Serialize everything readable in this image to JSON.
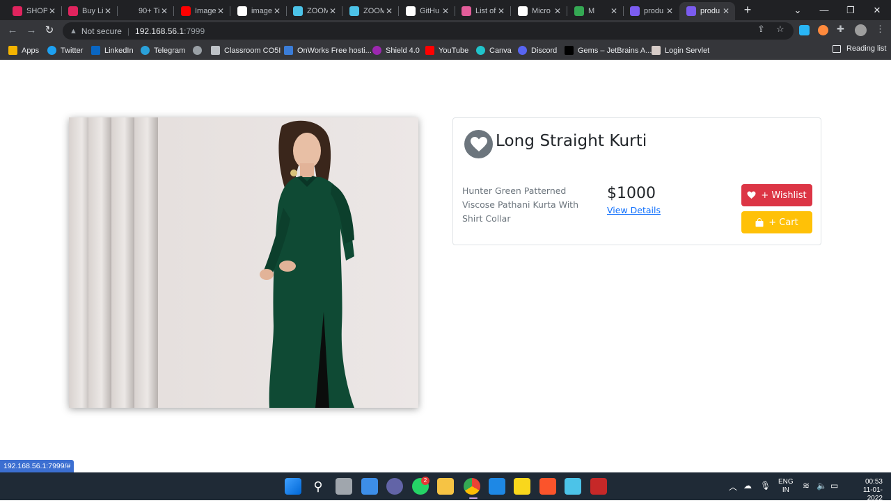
{
  "browser": {
    "tabs": [
      {
        "title": "SHOPI",
        "icon": "myntra-icon",
        "color": "#e0245e",
        "active": false
      },
      {
        "title": "Buy Li",
        "icon": "myntra-icon",
        "color": "#e0245e",
        "active": false
      },
      {
        "title": "90+ Ti",
        "icon": "t-icon",
        "color": "#202124",
        "active": false
      },
      {
        "title": "Image",
        "icon": "youtube-icon",
        "color": "#ff0000",
        "active": false
      },
      {
        "title": "image",
        "icon": "google-icon",
        "color": "#ffffff",
        "active": false
      },
      {
        "title": "ZOOM",
        "icon": "zoom-icon",
        "color": "#4cc3e8",
        "active": false
      },
      {
        "title": "ZOOM",
        "icon": "zoom-icon",
        "color": "#4cc3e8",
        "active": false
      },
      {
        "title": "GitHu",
        "icon": "github-icon",
        "color": "#ffffff",
        "active": false
      },
      {
        "title": "List of",
        "icon": "list-icon",
        "color": "#e35d9a",
        "active": false
      },
      {
        "title": "Micro",
        "icon": "amazon-icon",
        "color": "#ffffff",
        "active": false
      },
      {
        "title": "M",
        "icon": "meet-icon",
        "color": "#34a853",
        "active": false
      },
      {
        "title": "produ",
        "icon": "product-icon",
        "color": "#7b5cf0",
        "active": false
      },
      {
        "title": "produ",
        "icon": "product-icon",
        "color": "#7b5cf0",
        "active": true
      }
    ],
    "address": {
      "security_label": "Not secure",
      "host": "192.168.56.1",
      "port": ":7999"
    },
    "bookmarks": [
      {
        "label": "Apps",
        "icon": "apps-grid-icon",
        "color": "#f4b400"
      },
      {
        "label": "Twitter",
        "icon": "twitter-icon",
        "color": "#1da1f2"
      },
      {
        "label": "LinkedIn",
        "icon": "linkedin-icon",
        "color": "#0a66c2"
      },
      {
        "label": "Telegram",
        "icon": "telegram-icon",
        "color": "#2aa1da"
      },
      {
        "label": "",
        "icon": "globe-icon",
        "color": "#9aa0a6"
      },
      {
        "label": "Classroom CO5I",
        "icon": "classroom-icon",
        "color": "#bdc1c6"
      },
      {
        "label": "OnWorks Free hosti...",
        "icon": "onworks-icon",
        "color": "#3b7dd8"
      },
      {
        "label": "Shield 4.0",
        "icon": "shield-icon",
        "color": "#9c27b0"
      },
      {
        "label": "YouTube",
        "icon": "youtube-icon",
        "color": "#ff0000"
      },
      {
        "label": "Canva",
        "icon": "canva-icon",
        "color": "#20c4cb"
      },
      {
        "label": "Discord",
        "icon": "discord-icon",
        "color": "#5865f2"
      },
      {
        "label": "Gems – JetBrains A...",
        "icon": "jetbrains-icon",
        "color": "#000000"
      },
      {
        "label": "Login Servlet",
        "icon": "servlet-icon",
        "color": "#d7ccc8"
      }
    ],
    "reading_list": "Reading list",
    "status_url": "192.168.56.1:7999/#"
  },
  "product": {
    "title": "Long Straight Kurti",
    "description": "Hunter Green Patterned Viscose Pathani Kurta With Shirt Collar",
    "price": "$1000",
    "details_link": "View Details",
    "wishlist_button": "+ Wishlist",
    "cart_button": "+ Cart",
    "colors": {
      "wishlist": "#dc3545",
      "cart": "#ffc107",
      "link": "#0d6efd",
      "heart_circle": "#6c757d",
      "kurta": "#0f4a34"
    }
  },
  "taskbar": {
    "whatsapp_badge": "2",
    "language": "ENG",
    "region": "IN",
    "time": "00:53",
    "date": "11-01-2022"
  }
}
